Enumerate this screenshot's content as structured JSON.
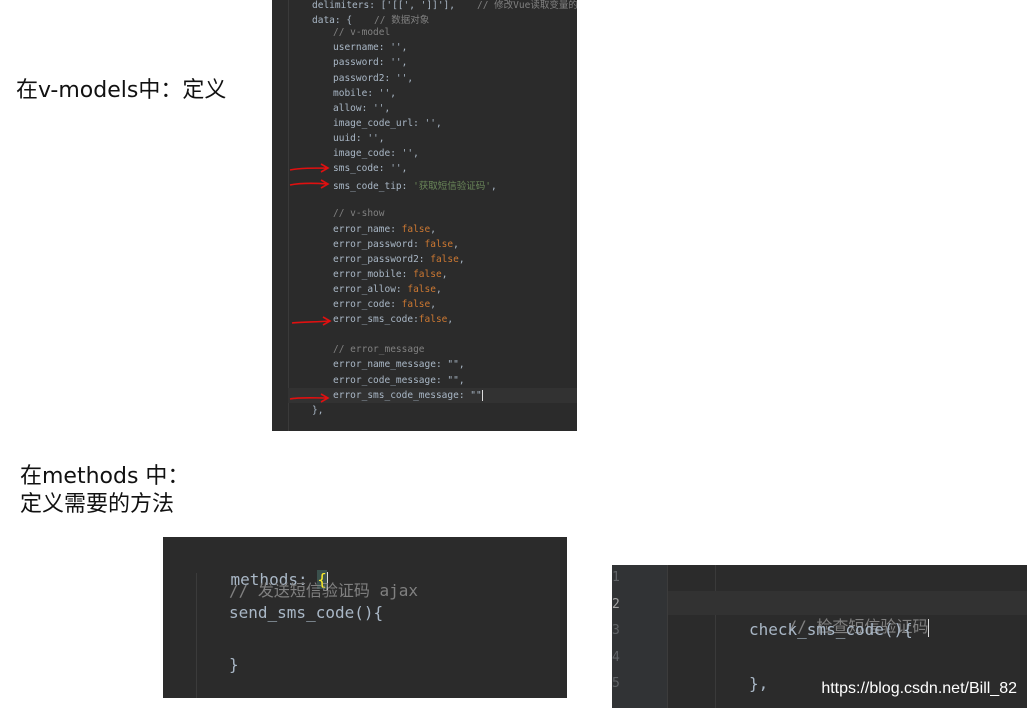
{
  "notes": {
    "vmodels": "在v-models中：定义",
    "methods_line1": "在methods 中：",
    "methods_line2": "定义需要的方法"
  },
  "top_code": {
    "lines": [
      {
        "a": "delimiters: ['[[', ']]'],",
        "c": "// 修改Vue读取变量的语法"
      },
      {
        "a": "data: {",
        "c": "// 数据对象"
      },
      {
        "c": "// v-model"
      },
      {
        "a": "username: '',"
      },
      {
        "a": "password: '',"
      },
      {
        "a": "password2: '',"
      },
      {
        "a": "mobile: '',"
      },
      {
        "a": "allow: '',"
      },
      {
        "a": "image_code_url: '',"
      },
      {
        "a": "uuid: '',"
      },
      {
        "a": "image_code: '',"
      },
      {
        "a": "sms_code: '',"
      },
      {
        "a": "sms_code_tip: ",
        "s": "'获取短信验证码'",
        "b": ","
      },
      {},
      {
        "c": "// v-show"
      },
      {
        "a": "error_name: ",
        "k": "false",
        "b": ","
      },
      {
        "a": "error_password: ",
        "k": "false",
        "b": ","
      },
      {
        "a": "error_password2: ",
        "k": "false",
        "b": ","
      },
      {
        "a": "error_mobile: ",
        "k": "false",
        "b": ","
      },
      {
        "a": "error_allow: ",
        "k": "false",
        "b": ","
      },
      {
        "a": "error_code: ",
        "k": "false",
        "b": ","
      },
      {
        "a": "error_sms_code:",
        "k": "false",
        "b": ","
      },
      {},
      {
        "c": "// error_message"
      },
      {
        "a": "error_name_message: \"\","
      },
      {
        "a": "error_code_message: \"\","
      },
      {
        "a": "error_sms_code_message: \"\""
      },
      {
        "a": "},"
      }
    ]
  },
  "methods_code": {
    "line1": "methods: ",
    "brace": "{",
    "comment": "// 发送短信验证码 ajax",
    "func": "send_sms_code(){",
    "close": "}"
  },
  "check_code": {
    "line_numbers": [
      "1",
      "2",
      "3",
      "4",
      "5"
    ],
    "comment": "// 检查短信验证码",
    "func": "check_sms_code(){",
    "close": "},"
  },
  "watermark": "https://blog.csdn.net/Bill_82",
  "colors": {
    "editor_bg": "#2b2b2b",
    "keyword": "#cc7832",
    "string": "#6a8759",
    "comment": "#808080",
    "text": "#a9b7c6",
    "arrow": "#e01010"
  }
}
